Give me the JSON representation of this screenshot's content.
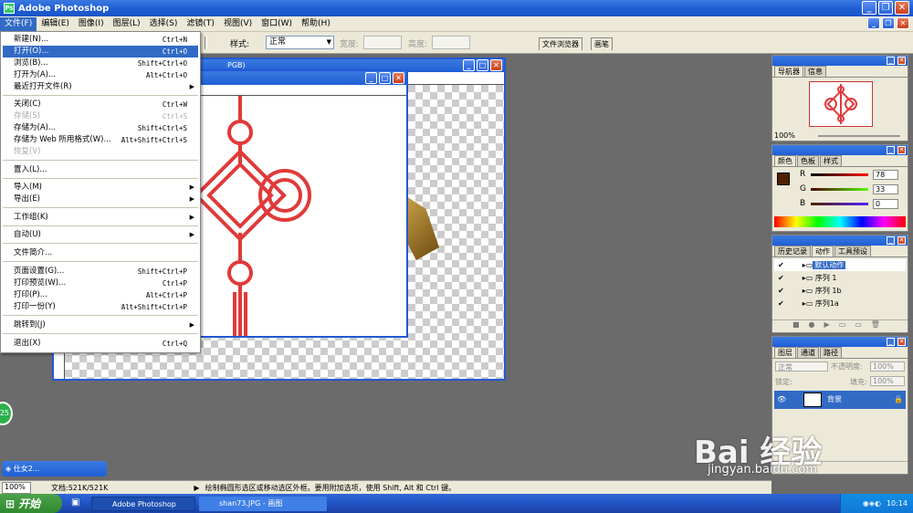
{
  "app": {
    "title": "Adobe Photoshop"
  },
  "menubar": [
    "文件(F)",
    "编辑(E)",
    "图像(I)",
    "图层(L)",
    "选择(S)",
    "滤镜(T)",
    "视图(V)",
    "窗口(W)",
    "帮助(H)"
  ],
  "options": {
    "style_label": "样式:",
    "style_value": "正常",
    "width_label": "宽度:",
    "height_label": "高度:",
    "tab_browser": "文件浏览器",
    "tab_brush": "画笔"
  },
  "file_menu": [
    {
      "label": "新建(N)...",
      "shortcut": "Ctrl+N"
    },
    {
      "label": "打开(O)...",
      "shortcut": "Ctrl+O"
    },
    {
      "label": "浏览(B)...",
      "shortcut": "Shift+Ctrl+O"
    },
    {
      "label": "打开为(A)...",
      "shortcut": "Alt+Ctrl+O"
    },
    {
      "label": "最近打开文件(R)",
      "shortcut": ""
    },
    {
      "label": "关闭(C)",
      "shortcut": "Ctrl+W"
    },
    {
      "label": "存储(S)",
      "shortcut": "Ctrl+S"
    },
    {
      "label": "存储为(A)...",
      "shortcut": "Shift+Ctrl+S"
    },
    {
      "label": "存储为 Web 所用格式(W)...",
      "shortcut": "Alt+Shift+Ctrl+S"
    },
    {
      "label": "恢复(V)",
      "shortcut": ""
    },
    {
      "label": "置入(L)...",
      "shortcut": ""
    },
    {
      "label": "导入(M)",
      "shortcut": ""
    },
    {
      "label": "导出(E)",
      "shortcut": ""
    },
    {
      "label": "工作组(K)",
      "shortcut": ""
    },
    {
      "label": "自动(U)",
      "shortcut": ""
    },
    {
      "label": "文件简介...",
      "shortcut": ""
    },
    {
      "label": "页面设置(G)...",
      "shortcut": "Shift+Ctrl+P"
    },
    {
      "label": "打印预览(W)...",
      "shortcut": "Ctrl+P"
    },
    {
      "label": "打印(P)...",
      "shortcut": "Alt+Ctrl+P"
    },
    {
      "label": "打印一份(Y)",
      "shortcut": "Alt+Shift+Ctrl+P"
    },
    {
      "label": "跳转到(J)",
      "shortcut": ""
    },
    {
      "label": "退出(X)",
      "shortcut": "Ctrl+Q"
    }
  ],
  "navigator": {
    "tab1": "导航器",
    "tab2": "信息",
    "zoom": "100%"
  },
  "color": {
    "tab1": "颜色",
    "tab2": "色板",
    "tab3": "样式",
    "r_label": "R",
    "g_label": "G",
    "b_label": "B",
    "r": "78",
    "g": "33",
    "b": "0",
    "swatch": "#4e2100"
  },
  "actions": {
    "tab1": "历史记录",
    "tab2": "动作",
    "tab3": "工具预设",
    "items": [
      "默认动作",
      "序列 1",
      "序列 1b",
      "序列1a"
    ]
  },
  "layers": {
    "tab1": "图层",
    "tab2": "通道",
    "tab3": "路径",
    "mode": "正常",
    "opacity_label": "不透明度:",
    "opacity": "100%",
    "lock_label": "锁定:",
    "fill_label": "填充:",
    "fill": "100%",
    "layer_name": "背景"
  },
  "doc": {
    "title_fragment": "PGB)",
    "min_title": "仕女2..."
  },
  "statusbar": {
    "zoom": "100%",
    "doc_size": "文档:521K/521K",
    "hint": "绘制椭圆形选区或移动选区外框。要用附加选项，使用 Shift, Alt 和 Ctrl 键。"
  },
  "taskbar": {
    "start": "开始",
    "item1": "Adobe Photoshop",
    "item2": "shan73.JPG - 画图",
    "clock": "10:14"
  },
  "badge": {
    "text": "25"
  },
  "watermark": {
    "brand": "Bai 经验",
    "url": "jingyan.baidu.com"
  }
}
